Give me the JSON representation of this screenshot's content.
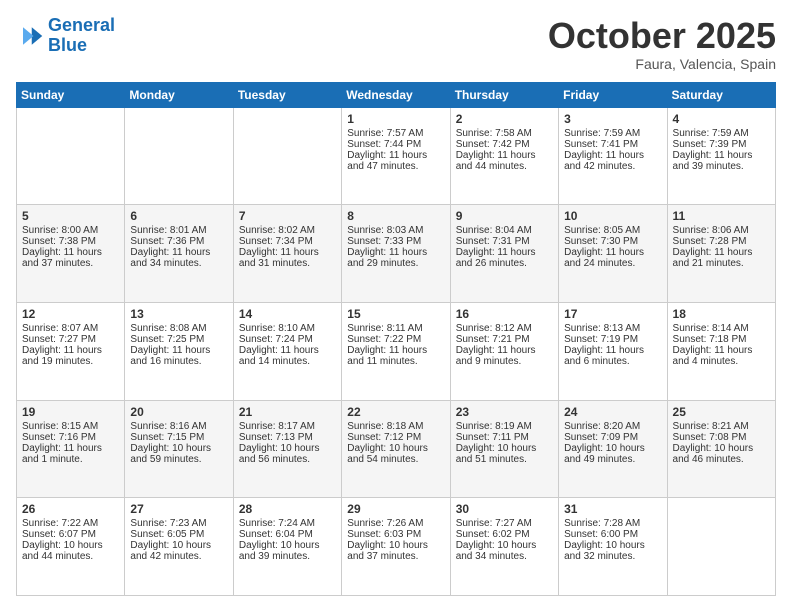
{
  "header": {
    "logo_line1": "General",
    "logo_line2": "Blue",
    "month": "October 2025",
    "location": "Faura, Valencia, Spain"
  },
  "weekdays": [
    "Sunday",
    "Monday",
    "Tuesday",
    "Wednesday",
    "Thursday",
    "Friday",
    "Saturday"
  ],
  "weeks": [
    [
      {
        "day": "",
        "info": ""
      },
      {
        "day": "",
        "info": ""
      },
      {
        "day": "",
        "info": ""
      },
      {
        "day": "1",
        "info": "Sunrise: 7:57 AM\nSunset: 7:44 PM\nDaylight: 11 hours and 47 minutes."
      },
      {
        "day": "2",
        "info": "Sunrise: 7:58 AM\nSunset: 7:42 PM\nDaylight: 11 hours and 44 minutes."
      },
      {
        "day": "3",
        "info": "Sunrise: 7:59 AM\nSunset: 7:41 PM\nDaylight: 11 hours and 42 minutes."
      },
      {
        "day": "4",
        "info": "Sunrise: 7:59 AM\nSunset: 7:39 PM\nDaylight: 11 hours and 39 minutes."
      }
    ],
    [
      {
        "day": "5",
        "info": "Sunrise: 8:00 AM\nSunset: 7:38 PM\nDaylight: 11 hours and 37 minutes."
      },
      {
        "day": "6",
        "info": "Sunrise: 8:01 AM\nSunset: 7:36 PM\nDaylight: 11 hours and 34 minutes."
      },
      {
        "day": "7",
        "info": "Sunrise: 8:02 AM\nSunset: 7:34 PM\nDaylight: 11 hours and 31 minutes."
      },
      {
        "day": "8",
        "info": "Sunrise: 8:03 AM\nSunset: 7:33 PM\nDaylight: 11 hours and 29 minutes."
      },
      {
        "day": "9",
        "info": "Sunrise: 8:04 AM\nSunset: 7:31 PM\nDaylight: 11 hours and 26 minutes."
      },
      {
        "day": "10",
        "info": "Sunrise: 8:05 AM\nSunset: 7:30 PM\nDaylight: 11 hours and 24 minutes."
      },
      {
        "day": "11",
        "info": "Sunrise: 8:06 AM\nSunset: 7:28 PM\nDaylight: 11 hours and 21 minutes."
      }
    ],
    [
      {
        "day": "12",
        "info": "Sunrise: 8:07 AM\nSunset: 7:27 PM\nDaylight: 11 hours and 19 minutes."
      },
      {
        "day": "13",
        "info": "Sunrise: 8:08 AM\nSunset: 7:25 PM\nDaylight: 11 hours and 16 minutes."
      },
      {
        "day": "14",
        "info": "Sunrise: 8:10 AM\nSunset: 7:24 PM\nDaylight: 11 hours and 14 minutes."
      },
      {
        "day": "15",
        "info": "Sunrise: 8:11 AM\nSunset: 7:22 PM\nDaylight: 11 hours and 11 minutes."
      },
      {
        "day": "16",
        "info": "Sunrise: 8:12 AM\nSunset: 7:21 PM\nDaylight: 11 hours and 9 minutes."
      },
      {
        "day": "17",
        "info": "Sunrise: 8:13 AM\nSunset: 7:19 PM\nDaylight: 11 hours and 6 minutes."
      },
      {
        "day": "18",
        "info": "Sunrise: 8:14 AM\nSunset: 7:18 PM\nDaylight: 11 hours and 4 minutes."
      }
    ],
    [
      {
        "day": "19",
        "info": "Sunrise: 8:15 AM\nSunset: 7:16 PM\nDaylight: 11 hours and 1 minute."
      },
      {
        "day": "20",
        "info": "Sunrise: 8:16 AM\nSunset: 7:15 PM\nDaylight: 10 hours and 59 minutes."
      },
      {
        "day": "21",
        "info": "Sunrise: 8:17 AM\nSunset: 7:13 PM\nDaylight: 10 hours and 56 minutes."
      },
      {
        "day": "22",
        "info": "Sunrise: 8:18 AM\nSunset: 7:12 PM\nDaylight: 10 hours and 54 minutes."
      },
      {
        "day": "23",
        "info": "Sunrise: 8:19 AM\nSunset: 7:11 PM\nDaylight: 10 hours and 51 minutes."
      },
      {
        "day": "24",
        "info": "Sunrise: 8:20 AM\nSunset: 7:09 PM\nDaylight: 10 hours and 49 minutes."
      },
      {
        "day": "25",
        "info": "Sunrise: 8:21 AM\nSunset: 7:08 PM\nDaylight: 10 hours and 46 minutes."
      }
    ],
    [
      {
        "day": "26",
        "info": "Sunrise: 7:22 AM\nSunset: 6:07 PM\nDaylight: 10 hours and 44 minutes."
      },
      {
        "day": "27",
        "info": "Sunrise: 7:23 AM\nSunset: 6:05 PM\nDaylight: 10 hours and 42 minutes."
      },
      {
        "day": "28",
        "info": "Sunrise: 7:24 AM\nSunset: 6:04 PM\nDaylight: 10 hours and 39 minutes."
      },
      {
        "day": "29",
        "info": "Sunrise: 7:26 AM\nSunset: 6:03 PM\nDaylight: 10 hours and 37 minutes."
      },
      {
        "day": "30",
        "info": "Sunrise: 7:27 AM\nSunset: 6:02 PM\nDaylight: 10 hours and 34 minutes."
      },
      {
        "day": "31",
        "info": "Sunrise: 7:28 AM\nSunset: 6:00 PM\nDaylight: 10 hours and 32 minutes."
      },
      {
        "day": "",
        "info": ""
      }
    ]
  ]
}
